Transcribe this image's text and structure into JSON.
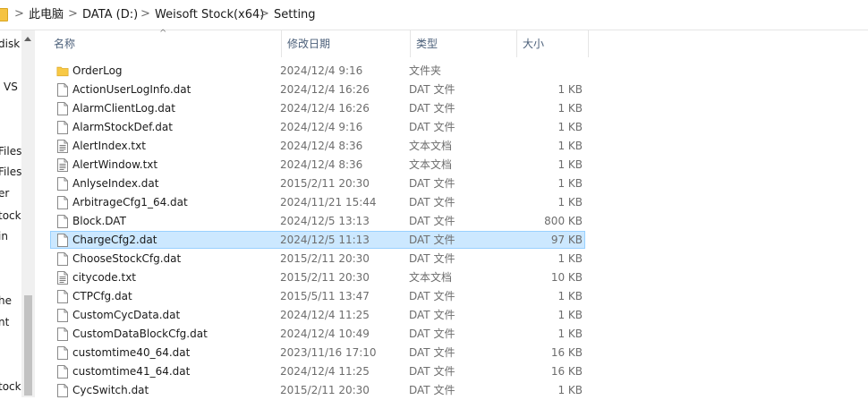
{
  "breadcrumb": {
    "items": [
      "此电脑",
      "DATA (D:)",
      "Weisoft Stock(x64)",
      "Setting"
    ],
    "separator": ">"
  },
  "nav": {
    "items": [
      "disk",
      "VS",
      "Files",
      "Files",
      "er",
      "tock",
      "in",
      "he",
      "nt",
      "tock"
    ]
  },
  "columns": {
    "name": "名称",
    "date": "修改日期",
    "type": "类型",
    "size": "大小"
  },
  "files": [
    {
      "name": "OrderLog",
      "date": "2024/12/4 9:16",
      "type": "文件夹",
      "size": "",
      "icon": "folder-icon"
    },
    {
      "name": "ActionUserLogInfo.dat",
      "date": "2024/12/4 16:26",
      "type": "DAT 文件",
      "size": "1 KB",
      "icon": "file-icon"
    },
    {
      "name": "AlarmClientLog.dat",
      "date": "2024/12/4 16:26",
      "type": "DAT 文件",
      "size": "1 KB",
      "icon": "file-icon"
    },
    {
      "name": "AlarmStockDef.dat",
      "date": "2024/12/4 9:16",
      "type": "DAT 文件",
      "size": "1 KB",
      "icon": "file-icon"
    },
    {
      "name": "AlertIndex.txt",
      "date": "2024/12/4 8:36",
      "type": "文本文档",
      "size": "1 KB",
      "icon": "text-file-icon"
    },
    {
      "name": "AlertWindow.txt",
      "date": "2024/12/4 8:36",
      "type": "文本文档",
      "size": "1 KB",
      "icon": "text-file-icon"
    },
    {
      "name": "AnlyseIndex.dat",
      "date": "2015/2/11 20:30",
      "type": "DAT 文件",
      "size": "1 KB",
      "icon": "file-icon"
    },
    {
      "name": "ArbitrageCfg1_64.dat",
      "date": "2024/11/21 15:44",
      "type": "DAT 文件",
      "size": "1 KB",
      "icon": "file-icon"
    },
    {
      "name": "Block.DAT",
      "date": "2024/12/5 13:13",
      "type": "DAT 文件",
      "size": "800 KB",
      "icon": "file-icon"
    },
    {
      "name": "ChargeCfg2.dat",
      "date": "2024/12/5 11:13",
      "type": "DAT 文件",
      "size": "97 KB",
      "icon": "file-icon",
      "selected": true
    },
    {
      "name": "ChooseStockCfg.dat",
      "date": "2015/2/11 20:30",
      "type": "DAT 文件",
      "size": "1 KB",
      "icon": "file-icon"
    },
    {
      "name": "citycode.txt",
      "date": "2015/2/11 20:30",
      "type": "文本文档",
      "size": "10 KB",
      "icon": "text-file-icon"
    },
    {
      "name": "CTPCfg.dat",
      "date": "2015/5/11 13:47",
      "type": "DAT 文件",
      "size": "1 KB",
      "icon": "file-icon"
    },
    {
      "name": "CustomCycData.dat",
      "date": "2024/12/4 11:25",
      "type": "DAT 文件",
      "size": "1 KB",
      "icon": "file-icon"
    },
    {
      "name": "CustomDataBlockCfg.dat",
      "date": "2024/12/4 10:49",
      "type": "DAT 文件",
      "size": "1 KB",
      "icon": "file-icon"
    },
    {
      "name": "customtime40_64.dat",
      "date": "2023/11/16 17:10",
      "type": "DAT 文件",
      "size": "16 KB",
      "icon": "file-icon"
    },
    {
      "name": "customtime41_64.dat",
      "date": "2024/12/4 11:25",
      "type": "DAT 文件",
      "size": "16 KB",
      "icon": "file-icon"
    },
    {
      "name": "CycSwitch.dat",
      "date": "2015/2/11 20:30",
      "type": "DAT 文件",
      "size": "1 KB",
      "icon": "file-icon"
    }
  ]
}
